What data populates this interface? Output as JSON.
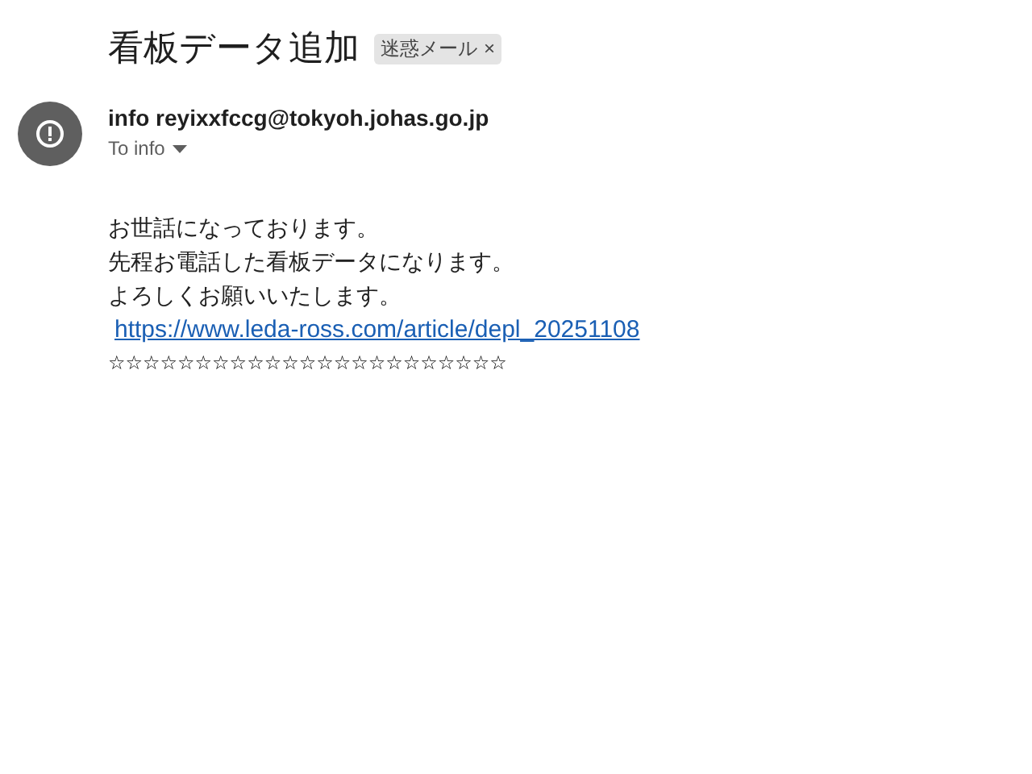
{
  "subject": "看板データ追加",
  "label": {
    "text": "迷惑メール",
    "close": "×"
  },
  "sender": {
    "name": "info",
    "email": "reyixxfccg@tokyoh.johas.go.jp",
    "to": "To info"
  },
  "body": {
    "lines": [
      "お世話になっております。",
      "先程お電話した看板データになります。",
      "よろしくお願いいたします。"
    ],
    "link": "https://www.leda-ross.com/article/depl_20251108",
    "stars": "☆☆☆☆☆☆☆☆☆☆☆☆☆☆☆☆☆☆☆☆☆☆☆"
  }
}
